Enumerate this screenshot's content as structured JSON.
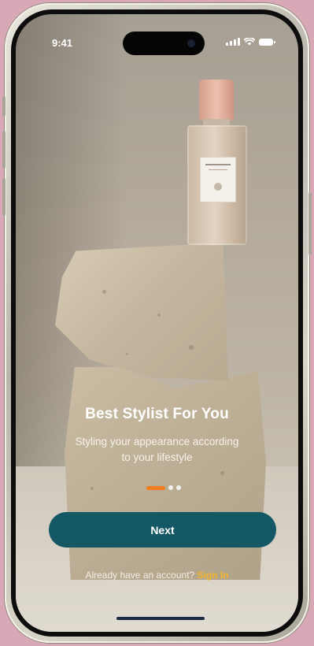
{
  "status_bar": {
    "time": "9:41"
  },
  "onboarding": {
    "title": "Best Stylist For You",
    "subtitle": "Styling your appearance according to your lifestyle",
    "page_indicator": {
      "pages": 3,
      "active": 1
    },
    "next_label": "Next",
    "signin_prompt": "Already have an account?",
    "signin_link": "Sign In"
  },
  "colors": {
    "primary_button": "#145866",
    "active_dot": "#f07e1f",
    "link": "#f2b62a",
    "page_background": "#d9a8b6"
  }
}
